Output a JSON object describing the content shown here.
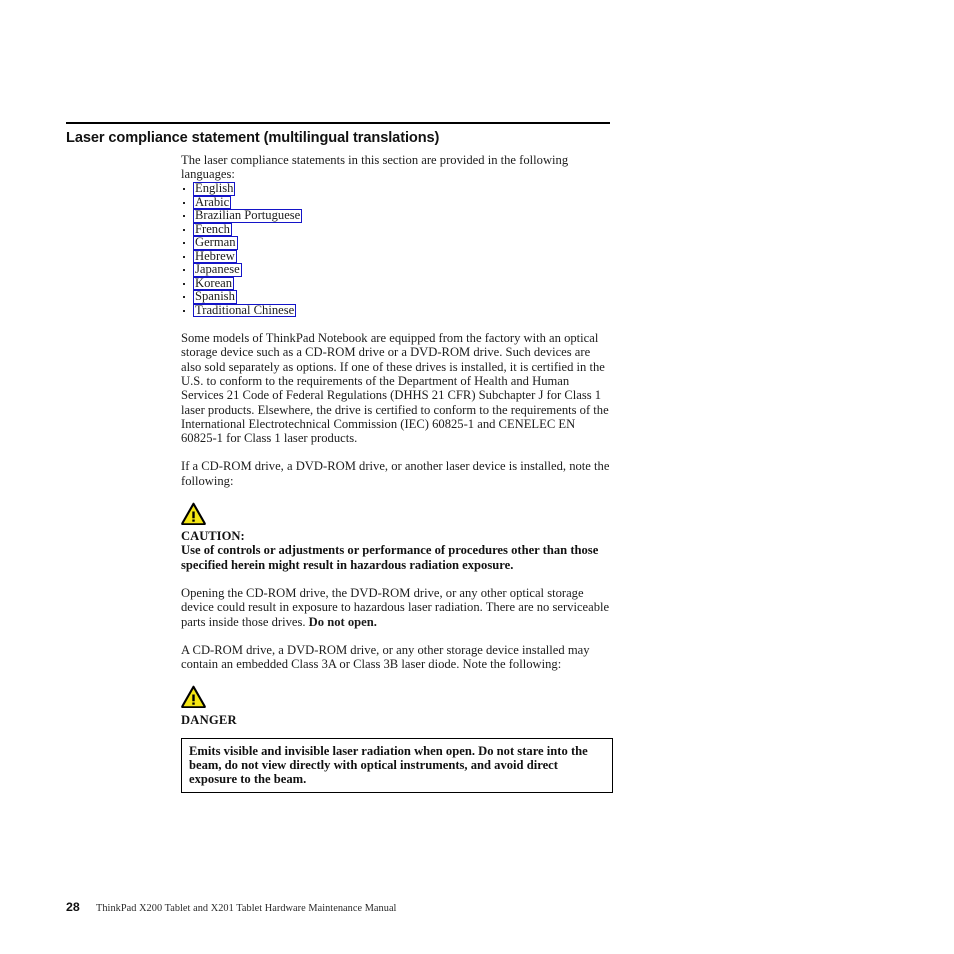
{
  "document": {
    "heading": "Laser compliance statement (multilingual translations)",
    "intro_paragraph": "The laser compliance statements in this section are provided in the following languages:",
    "language_links": [
      {
        "label": "English"
      },
      {
        "label": "Arabic"
      },
      {
        "label": "Brazilian Portuguese"
      },
      {
        "label": "French"
      },
      {
        "label": "German"
      },
      {
        "label": "Hebrew"
      },
      {
        "label": "Japanese"
      },
      {
        "label": "Korean"
      },
      {
        "label": "Spanish"
      },
      {
        "label": "Traditional Chinese"
      }
    ],
    "paragraph_models": "Some models of ThinkPad Notebook are equipped from the factory with an optical storage device such as a CD-ROM drive or a DVD-ROM drive. Such devices are also sold separately as options. If one of these drives is installed, it is certified in the U.S. to conform to the requirements of the Department of Health and Human Services 21 Code of Federal Regulations (DHHS 21 CFR) Subchapter J for Class 1 laser products. Elsewhere, the drive is certified to conform to the requirements of the International Electrotechnical Commission (IEC) 60825-1 and CENELEC EN 60825-1 for Class 1 laser products.",
    "paragraph_if_installed": "If a CD-ROM drive, a DVD-ROM drive, or another laser device is installed, note the following:",
    "caution": {
      "icon": "warning-triangle-icon",
      "label": "CAUTION:",
      "text": "Use of controls or adjustments or performance of procedures other than those specified herein might result in hazardous radiation exposure."
    },
    "paragraph_opening_prefix": "Opening the CD-ROM drive, the DVD-ROM drive, or any other optical storage device could result in exposure to hazardous laser radiation. There are no serviceable parts inside those drives. ",
    "paragraph_opening_bold": "Do not open.",
    "paragraph_class3": "A CD-ROM drive, a DVD-ROM drive, or any other storage device installed may contain an embedded Class 3A or Class 3B laser diode. Note the following:",
    "danger": {
      "icon": "warning-triangle-icon",
      "label": "DANGER",
      "text": "Emits visible and invisible laser radiation when open. Do not stare into the beam, do not view directly with optical instruments, and avoid direct exposure to the beam."
    },
    "footer": {
      "page_number": "28",
      "book_title": "ThinkPad X200 Tablet and X201 Tablet Hardware Maintenance Manual"
    },
    "colors": {
      "link_border": "#1414c8",
      "warning_fill": "#f5e614",
      "warning_stroke": "#000000",
      "text": "#1c1c1c",
      "page_background": "#ffffff"
    }
  }
}
